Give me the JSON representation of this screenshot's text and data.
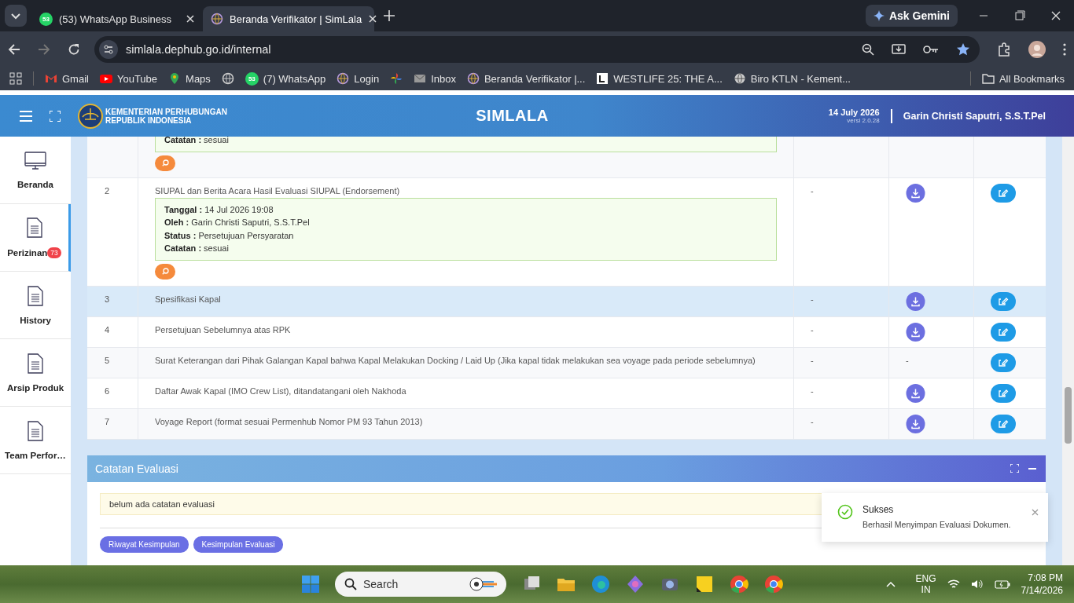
{
  "browser": {
    "tabs": [
      {
        "title": "(53) WhatsApp Business",
        "icon_badge": "53",
        "selected": false
      },
      {
        "title": "Beranda Verifikator | SimLala",
        "selected": true
      }
    ],
    "ask_gemini": "Ask Gemini",
    "url": "simlala.dephub.go.id/internal",
    "bookmarks": [
      {
        "kind": "link",
        "label": "Gmail"
      },
      {
        "kind": "link",
        "label": "YouTube"
      },
      {
        "kind": "link",
        "label": "Maps"
      },
      {
        "kind": "icon"
      },
      {
        "kind": "link",
        "label": "(7) WhatsApp",
        "icon_badge": "53"
      },
      {
        "kind": "link",
        "label": "Login"
      },
      {
        "kind": "icon"
      },
      {
        "kind": "link",
        "label": "Inbox"
      },
      {
        "kind": "link",
        "label": "Beranda Verifikator |..."
      },
      {
        "kind": "link",
        "label": "WESTLIFE 25: THE A..."
      },
      {
        "kind": "link",
        "label": "Biro KTLN - Kement..."
      }
    ],
    "all_bookmarks": "All Bookmarks"
  },
  "header": {
    "org_line_1": "KEMENTERIAN PERHUBUNGAN",
    "org_line_2": "REPUBLIK INDONESIA",
    "title": "SIMLALA",
    "date": "14 July 2026",
    "version": "versi 2.0.28",
    "user": "Garin Christi Saputri, S.S.T.Pel"
  },
  "sidebar": {
    "items": [
      {
        "label": "Beranda",
        "kind": "monitor",
        "selected": false
      },
      {
        "label": "Perizinan",
        "kind": "document",
        "badge": "73",
        "selected": true
      },
      {
        "label": "History",
        "kind": "document",
        "selected": false
      },
      {
        "label": "Arsip Produk",
        "kind": "document",
        "selected": false
      },
      {
        "label": "Team Perfor…",
        "kind": "document",
        "selected": false
      }
    ]
  },
  "documents": {
    "rows": [
      {
        "note": [
          {
            "label": "Catatan :",
            "value": "sesuai"
          }
        ],
        "preview": true,
        "hovered": false
      },
      {
        "number": "2",
        "document": "SIUPAL dan Berita Acara Hasil Evaluasi SIUPAL (Endorsement)",
        "note": [
          {
            "label": "Tanggal :",
            "value": "14 Jul 2026 19:08"
          },
          {
            "label": "Oleh :",
            "value": "Garin Christi Saputri, S.S.T.Pel"
          },
          {
            "label": "Status :",
            "value": "Persetujuan Persyaratan"
          },
          {
            "label": "Catatan :",
            "value": "sesuai"
          }
        ],
        "preview": true,
        "column_3": "-",
        "download": {
          "kind": "button"
        },
        "edit": true,
        "hovered": false
      },
      {
        "number": "3",
        "document": "Spesifikasi Kapal",
        "column_3": "-",
        "download": {
          "kind": "button"
        },
        "edit": true,
        "hovered": true
      },
      {
        "number": "4",
        "document": "Persetujuan Sebelumnya atas RPK",
        "column_3": "-",
        "download": {
          "kind": "button"
        },
        "edit": true,
        "hovered": false
      },
      {
        "number": "5",
        "document": "Surat Keterangan dari Pihak Galangan Kapal bahwa Kapal Melakukan Docking / Laid Up (Jika kapal tidak melakukan sea voyage pada periode sebelumnya)",
        "column_3": "-",
        "download": {
          "kind": "text",
          "text": "-"
        },
        "edit": true,
        "hovered": false
      },
      {
        "number": "6",
        "document": "Daftar Awak Kapal (IMO Crew List), ditandatangani oleh Nakhoda",
        "column_3": "-",
        "download": {
          "kind": "button"
        },
        "edit": true,
        "hovered": false
      },
      {
        "number": "7",
        "document": "Voyage Report (format sesuai Permenhub Nomor PM 93 Tahun 2013)",
        "column_3": "-",
        "download": {
          "kind": "button"
        },
        "edit": true,
        "hovered": false
      }
    ]
  },
  "evaluation_panel": {
    "title": "Catatan Evaluasi",
    "note": "belum ada catatan evaluasi",
    "buttons": [
      "Riwayat Kesimpulan",
      "Kesimpulan Evaluasi"
    ]
  },
  "toast": {
    "title": "Sukses",
    "message": "Berhasil Menyimpan Evaluasi Dokumen."
  },
  "taskbar": {
    "search_placeholder": "Search",
    "language": "ENG",
    "region": "IN",
    "time": "7:08 PM",
    "date": "7/14/2026"
  }
}
